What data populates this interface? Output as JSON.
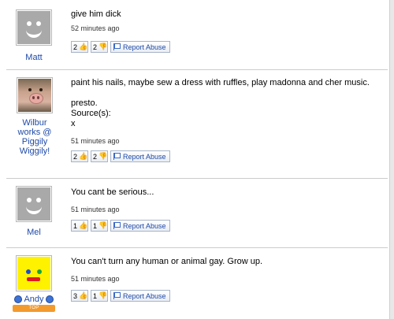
{
  "answers": [
    {
      "user": "Matt",
      "text": "give him dick",
      "time": "52 minutes ago",
      "thumbs_up": "2",
      "thumbs_down": "2",
      "report_label": "Report Abuse",
      "avatar": "gray-smiley"
    },
    {
      "user": "Wilbur works @ Piggily Wiggily!",
      "text": "paint his nails, maybe sew a dress with ruffles, play madonna and cher music.\n\npresto.\nSource(s):\nx",
      "time": "51 minutes ago",
      "thumbs_up": "2",
      "thumbs_down": "2",
      "report_label": "Report Abuse",
      "avatar": "pig-photo"
    },
    {
      "user": "Mel",
      "text": "You cant be serious...",
      "time": "51 minutes ago",
      "thumbs_up": "1",
      "thumbs_down": "1",
      "report_label": "Report Abuse",
      "avatar": "gray-smiley"
    },
    {
      "user": "Andy",
      "badge": "TOP CONTRIBUTOR",
      "text": "You can't turn any human or animal gay. Grow up.",
      "time": "51 minutes ago",
      "thumbs_up": "3",
      "thumbs_down": "1",
      "report_label": "Report Abuse",
      "avatar": "yellow-smiley"
    }
  ],
  "colors": {
    "link": "#1f4aa8",
    "badge": "#f39a2e",
    "separator": "#cccccc"
  }
}
